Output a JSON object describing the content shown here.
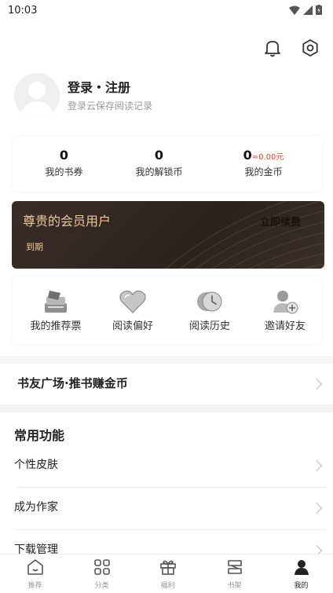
{
  "status_bar": {
    "time": "10:03"
  },
  "profile": {
    "name": "登录・注册",
    "subtitle": "登录云保存阅读记录"
  },
  "stats": [
    {
      "value": "0",
      "extra": "",
      "label": "我的书券"
    },
    {
      "value": "0",
      "extra": "",
      "label": "我的解锁币"
    },
    {
      "value": "0",
      "extra": "≈0.00元",
      "label": "我的金币"
    }
  ],
  "vip": {
    "title": "尊贵的会员用户",
    "expire": "到期",
    "renew": "立即续费"
  },
  "tools": [
    {
      "label": "我的推荐票",
      "icon": "ticket-icon"
    },
    {
      "label": "阅读偏好",
      "icon": "heart-icon"
    },
    {
      "label": "阅读历史",
      "icon": "history-icon"
    },
    {
      "label": "邀请好友",
      "icon": "invite-icon"
    }
  ],
  "plaza": {
    "label": "书友广场·推书赚金币"
  },
  "common": {
    "title": "常用功能",
    "items": [
      "个性皮肤",
      "成为作家",
      "下载管理"
    ]
  },
  "tabs": [
    {
      "label": "推荐",
      "icon": "home-icon"
    },
    {
      "label": "分类",
      "icon": "category-icon"
    },
    {
      "label": "福利",
      "icon": "gift-icon"
    },
    {
      "label": "书架",
      "icon": "bookshelf-icon"
    },
    {
      "label": "我的",
      "icon": "profile-icon"
    }
  ],
  "colors": {
    "vip_gold": "#e9c79a",
    "coin_red": "#e5452f"
  }
}
